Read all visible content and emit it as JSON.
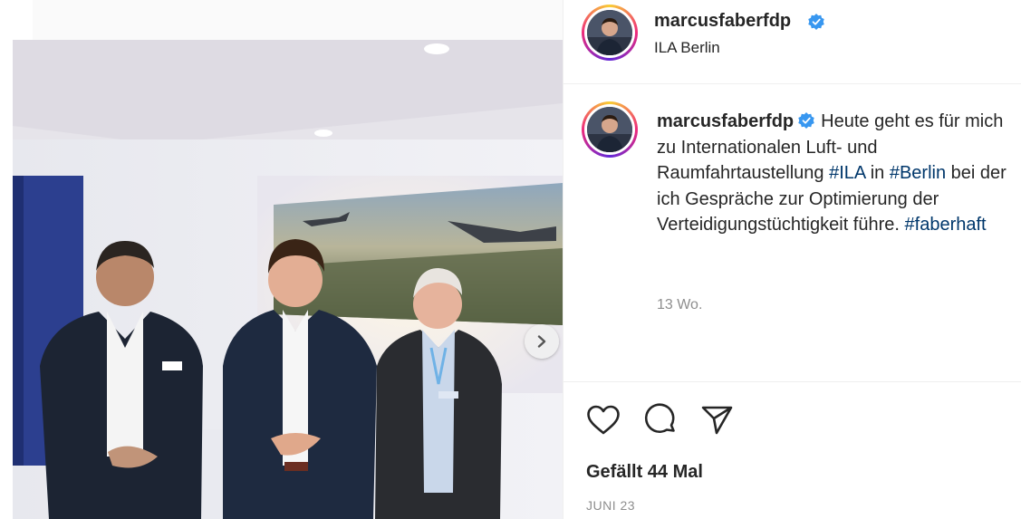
{
  "post": {
    "username": "marcusfaberfdp",
    "location": "ILA Berlin",
    "verified": true,
    "caption_parts": {
      "t1": "Heute geht es für mich zu Internationalen Luft- und Raumfahrtaustellung ",
      "tag1": "#ILA",
      "t2": " in ",
      "tag2": "#Berlin",
      "t3": " bei der ich Gespräche zur Optimierung der Verteidigungstüchtigkeit führe. ",
      "tag3": "#faberhaft"
    },
    "caption_age": "13 Wo.",
    "likes": "Gefällt 44 Mal",
    "date": "JUNI 23"
  },
  "icons": {
    "like": "heart-icon",
    "comment": "comment-icon",
    "share": "paper-plane-icon",
    "next": "chevron-right-icon",
    "verified": "verified-badge-icon"
  },
  "colors": {
    "verified_blue": "#3897f0",
    "hashtag": "#00376b",
    "muted": "#8e8e8e"
  }
}
